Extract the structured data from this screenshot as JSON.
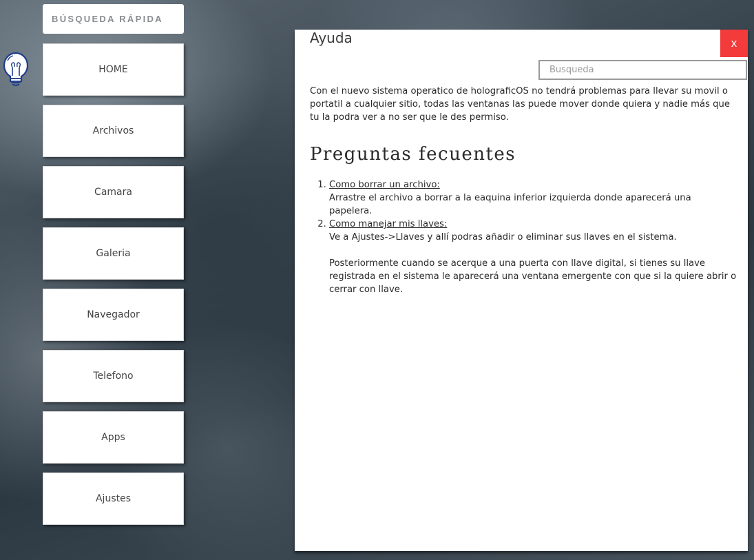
{
  "quick_search": {
    "label": "BÚSQUEDA RÁPIDA"
  },
  "menu": {
    "items": [
      {
        "id": "home",
        "label": "HOME"
      },
      {
        "id": "archivos",
        "label": "Archivos"
      },
      {
        "id": "camara",
        "label": "Camara"
      },
      {
        "id": "galeria",
        "label": "Galeria"
      },
      {
        "id": "navegador",
        "label": "Navegador"
      },
      {
        "id": "telefono",
        "label": "Telefono"
      },
      {
        "id": "apps",
        "label": "Apps"
      },
      {
        "id": "ajustes",
        "label": "Ajustes"
      }
    ]
  },
  "help_window": {
    "title": "Ayuda",
    "close_label": "x",
    "search": {
      "placeholder": "Busqueda",
      "value": ""
    },
    "intro": "Con el nuevo sistema operatico de holograficOS no tendrá problemas para llevar su movil o portatil a cualquier sitio, todas las ventanas las puede mover donde quiera  y nadie más que tu la podra ver a no ser que le des permiso.",
    "faq_heading": "Preguntas fecuentes",
    "faq": [
      {
        "question": "Como borrar un archivo:",
        "answer": "Arrastre el archivo a borrar a la eaquina inferior izquierda donde aparecerá una papelera.",
        "answer_extra": ""
      },
      {
        "question": "Como manejar mis llaves:",
        "answer": "Ve a Ajustes->Llaves y allí podras añadir o eliminar sus llaves en el sistema.",
        "answer_extra": "Posteriormente cuando se acerque a una puerta con llave digital, si tienes su llave registrada en el sistema le aparecerá una ventana emergente con que si la quiere abrir o cerrar con llave."
      }
    ]
  },
  "colors": {
    "close_button": "#f33b3b",
    "window_bg": "#ffffff",
    "text": "#2a2a2a",
    "bulb_outline": "#1f3d8a"
  },
  "icons": {
    "bulb": "lightbulb-icon"
  }
}
